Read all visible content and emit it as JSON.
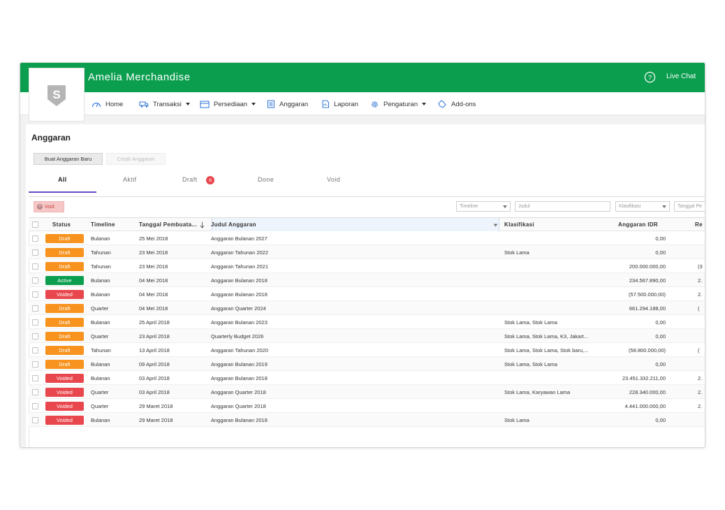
{
  "header": {
    "company": "Amelia Merchandise",
    "live_chat": "Live Chat",
    "logo_letter": "S"
  },
  "nav": [
    {
      "label": "Home",
      "icon": "dashboard-icon"
    },
    {
      "label": "Transaksi",
      "icon": "truck-icon"
    },
    {
      "label": "Persediaan",
      "icon": "inventory-icon"
    },
    {
      "label": "Anggaran",
      "icon": "budget-icon"
    },
    {
      "label": "Laporan",
      "icon": "report-icon"
    },
    {
      "label": "Pengaturan",
      "icon": "gear-icon"
    },
    {
      "label": "Add-ons",
      "icon": "puzzle-icon"
    }
  ],
  "page": {
    "title": "Anggaran",
    "new_button": "Buat Anggaran Baru",
    "print_button": "Cetak Anggaran"
  },
  "tabs": [
    {
      "label": "All"
    },
    {
      "label": "Aktif"
    },
    {
      "label": "Draft",
      "badge": "8"
    },
    {
      "label": "Done"
    },
    {
      "label": "Void"
    }
  ],
  "filters": {
    "active_chip": "Void",
    "timeline_placeholder": "Timeline",
    "judul_placeholder": "Judul",
    "klasifikasi_placeholder": "Klasifikasi",
    "tanggal_placeholder": "Tanggal Pe"
  },
  "columns": {
    "status": "Status",
    "timeline": "Timeline",
    "tanggal": "Tanggal Pembuata...",
    "judul": "Judul Anggaran",
    "klasifikasi": "Klasifikasi",
    "anggaran": "Anggaran IDR",
    "extra": "Re"
  },
  "colors": {
    "brand_green": "#0a9e4e",
    "draft": "#f7931e",
    "active": "#0a9e4e",
    "voided": "#e8474d",
    "tab_accent": "#6a4bc8"
  },
  "rows": [
    {
      "status": "Draft",
      "timeline": "Bulanan",
      "tanggal": "25 Mei 2018",
      "judul": "Anggaran Bulanan 2027",
      "klasifikasi": "",
      "anggaran": "0,00",
      "extra": ""
    },
    {
      "status": "Draft",
      "timeline": "Tahunan",
      "tanggal": "23 Mei 2018",
      "judul": "Anggaran Tahunan 2022",
      "klasifikasi": "Stok Lama",
      "anggaran": "0,00",
      "extra": ""
    },
    {
      "status": "Draft",
      "timeline": "Tahunan",
      "tanggal": "23 Mei 2018",
      "judul": "Anggaran Tahunan 2021",
      "klasifikasi": "",
      "anggaran": "200.000.000,00",
      "extra": "(3"
    },
    {
      "status": "Active",
      "timeline": "Bulanan",
      "tanggal": "04 Mei 2018",
      "judul": "Anggaran Bulanan 2018",
      "klasifikasi": "",
      "anggaran": "234.567.890,00",
      "extra": "2."
    },
    {
      "status": "Voided",
      "timeline": "Bulanan",
      "tanggal": "04 Mei 2018",
      "judul": "Anggaran Bulanan 2018",
      "klasifikasi": "",
      "anggaran": "(57.500.000,00)",
      "extra": "2."
    },
    {
      "status": "Draft",
      "timeline": "Quarter",
      "tanggal": "04 Mei 2018",
      "judul": "Anggaran Quarter 2024",
      "klasifikasi": "",
      "anggaran": "661.294.188,00",
      "extra": "("
    },
    {
      "status": "Draft",
      "timeline": "Bulanan",
      "tanggal": "25 April 2018",
      "judul": "Anggaran Bulanan 2023",
      "klasifikasi": "Stok Lama, Stok Lama",
      "anggaran": "0,00",
      "extra": ""
    },
    {
      "status": "Draft",
      "timeline": "Quarter",
      "tanggal": "23 April 2018",
      "judul": "Quarterly Budget 2026",
      "klasifikasi": "Stok Lama, Stok Lama, K3, Jakart...",
      "anggaran": "0,00",
      "extra": ""
    },
    {
      "status": "Draft",
      "timeline": "Tahunan",
      "tanggal": "13 April 2018",
      "judul": "Anggaran Tahunan 2020",
      "klasifikasi": "Stok Lama, Stok Lama, Stok baru,...",
      "anggaran": "(58.800.000,00)",
      "extra": "("
    },
    {
      "status": "Draft",
      "timeline": "Bulanan",
      "tanggal": "09 April 2018",
      "judul": "Anggaran Bulanan 2019",
      "klasifikasi": "Stok Lama, Stok Lama",
      "anggaran": "0,00",
      "extra": ""
    },
    {
      "status": "Voided",
      "timeline": "Bulanan",
      "tanggal": "03 April 2018",
      "judul": "Anggaran Bulanan 2018",
      "klasifikasi": "",
      "anggaran": "23.451.332.211,00",
      "extra": "2."
    },
    {
      "status": "Voided",
      "timeline": "Quarter",
      "tanggal": "03 April 2018",
      "judul": "Anggaran Quarter 2018",
      "klasifikasi": "Stok Lama, Karyawan Lama",
      "anggaran": "228.340.000,00",
      "extra": "2."
    },
    {
      "status": "Voided",
      "timeline": "Quarter",
      "tanggal": "29 Maret 2018",
      "judul": "Anggaran Quarter 2018",
      "klasifikasi": "",
      "anggaran": "4.441.000.000,00",
      "extra": "2."
    },
    {
      "status": "Voided",
      "timeline": "Bulanan",
      "tanggal": "29 Maret 2018",
      "judul": "Anggaran Bulanan 2018",
      "klasifikasi": "Stok Lama",
      "anggaran": "0,00",
      "extra": ""
    }
  ]
}
